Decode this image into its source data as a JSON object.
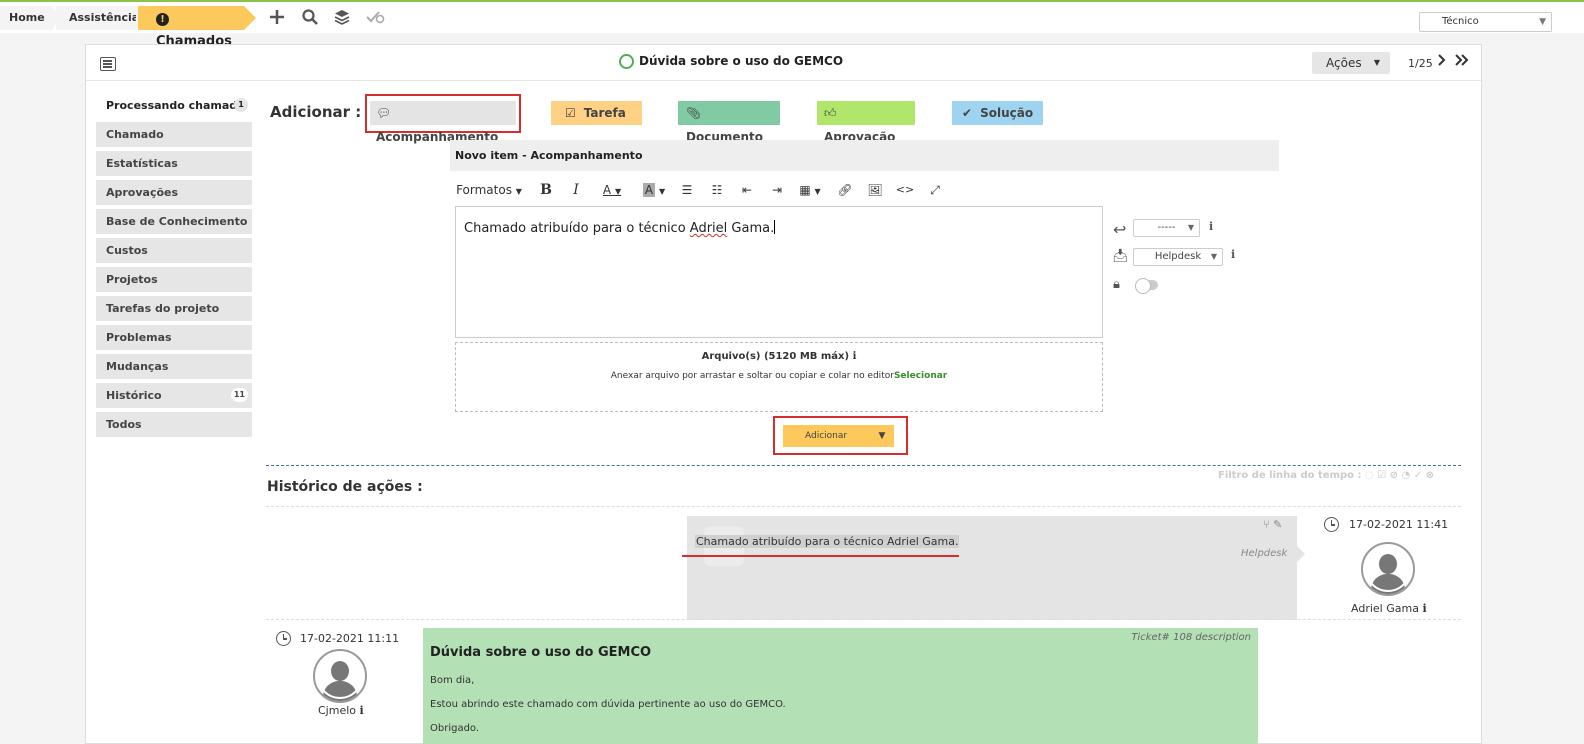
{
  "topbar": {
    "breadcrumbs": [
      "Home",
      "Assistência",
      "Chamados"
    ],
    "icons": [
      "plus-icon",
      "search-icon",
      "layers-icon",
      "check-gear-icon"
    ],
    "role": "Técnico"
  },
  "ticket": {
    "title": "Dúvida sobre o uso do GEMCO",
    "actions_label": "Ações",
    "pager": "1/25"
  },
  "sidebar": {
    "items": [
      {
        "label": "Processando chamado",
        "count": "1"
      },
      {
        "label": "Chamado"
      },
      {
        "label": "Estatísticas"
      },
      {
        "label": "Aprovações"
      },
      {
        "label": "Base de Conhecimento"
      },
      {
        "label": "Custos"
      },
      {
        "label": "Projetos"
      },
      {
        "label": "Tarefas do projeto"
      },
      {
        "label": "Problemas"
      },
      {
        "label": "Mudanças"
      },
      {
        "label": "Histórico",
        "count": "11"
      },
      {
        "label": "Todos"
      }
    ]
  },
  "add_bar": {
    "label": "Adicionar :",
    "buttons": [
      "Acompanhamento",
      "Tarefa",
      "Documento",
      "Aprovação",
      "Solução"
    ]
  },
  "editor": {
    "header": "Novo item - Acompanhamento",
    "formats_label": "Formatos",
    "content_before": "Chamado atribuído para o técnico ",
    "content_misspelled": "Adriel",
    "content_after": " Gama.",
    "source_value": "-----",
    "requesttype_value": "Helpdesk"
  },
  "upload": {
    "title": "Arquivo(s) (5120 MB máx)",
    "hint": "Anexar arquivo por arrastar e soltar ou copiar e colar no editor",
    "select_link": "Selecionar"
  },
  "submit_label": "Adicionar",
  "history": {
    "title": "Histórico de ações :",
    "filter_label": "Filtro de linha do tempo :",
    "entries": [
      {
        "text": "Chamado atribuído para o técnico Adriel Gama.",
        "source": "Helpdesk",
        "date": "17-02-2021 11:41",
        "user": "Adriel Gama"
      },
      {
        "tag": "Ticket# 108 description",
        "title": "Dúvida sobre o uso do GEMCO",
        "lines": [
          "Bom dia,",
          "Estou abrindo este chamado com dúvida pertinente ao uso do GEMCO.",
          "Obrigado."
        ],
        "date": "17-02-2021 11:11",
        "user": "Cjmelo"
      }
    ]
  }
}
